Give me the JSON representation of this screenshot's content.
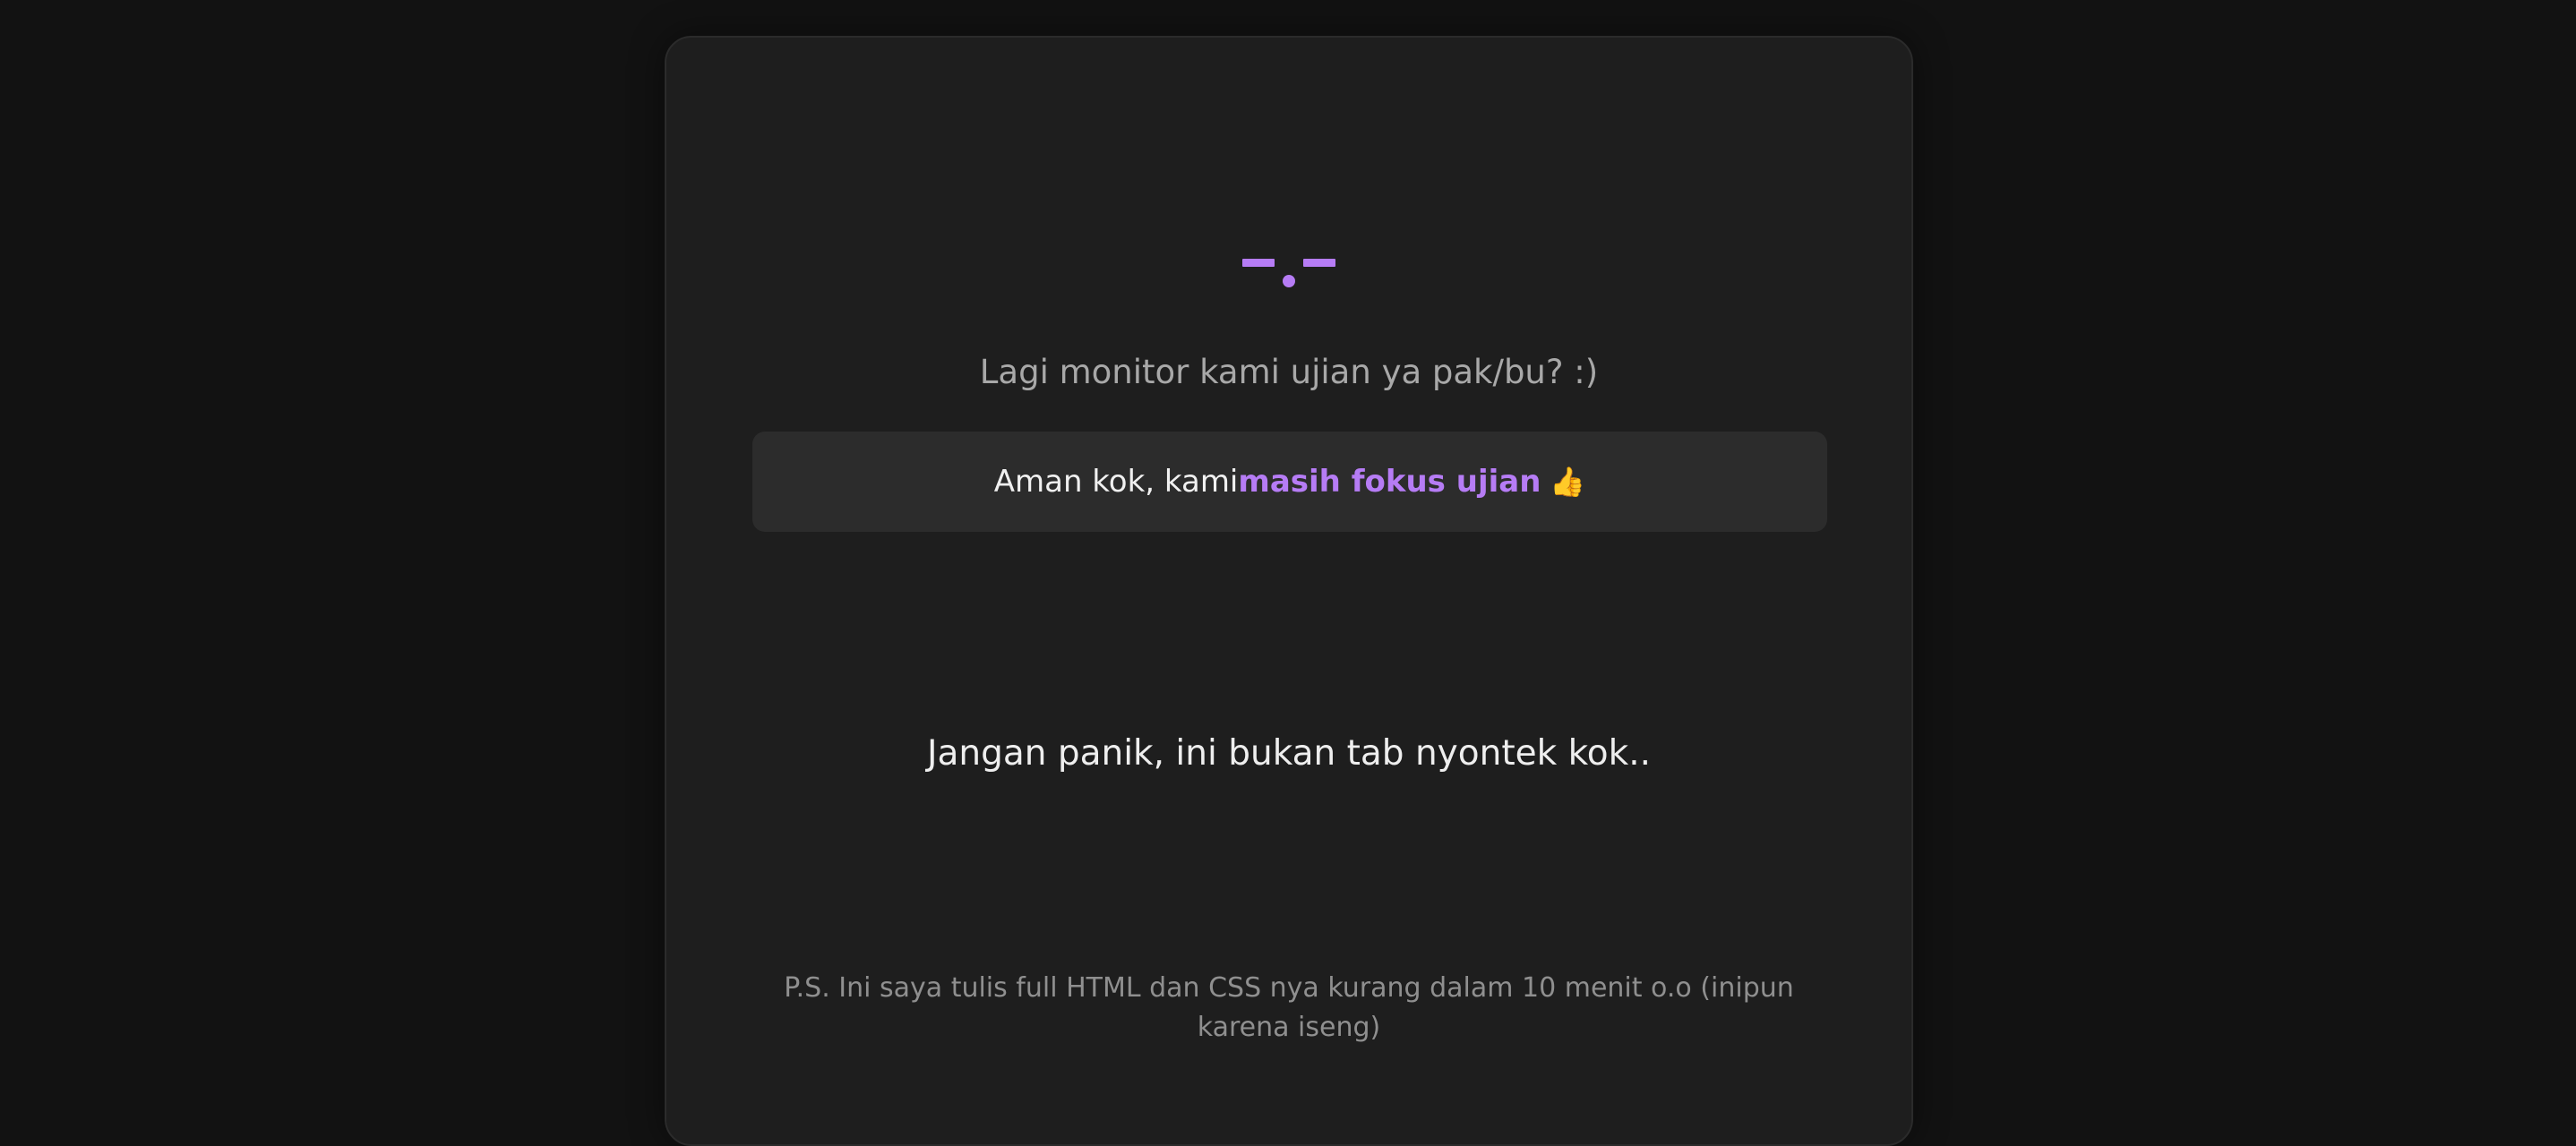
{
  "colors": {
    "page_background": "#121212",
    "card_background": "#1e1e1e",
    "notice_background": "#2c2c2c",
    "accent_purple": "#b67cf5",
    "muted_text": "#a8a8a8",
    "bright_text": "#eeeeee"
  },
  "face": {
    "icon": "face-glyph-icon",
    "text": "-.-"
  },
  "subtitle": "Lagi monitor kami ujian ya pak/bu? :)",
  "notice": {
    "prefix": "Aman kok, kami ",
    "highlight": "masih fokus ujian",
    "emoji": "👍",
    "emoji_icon": "thumbs-up-icon"
  },
  "main_message": "Jangan panik, ini bukan tab nyontek kok..",
  "footnote": "P.S. Ini saya tulis full HTML dan CSS nya kurang dalam 10 menit o.o (inipun karena iseng)"
}
